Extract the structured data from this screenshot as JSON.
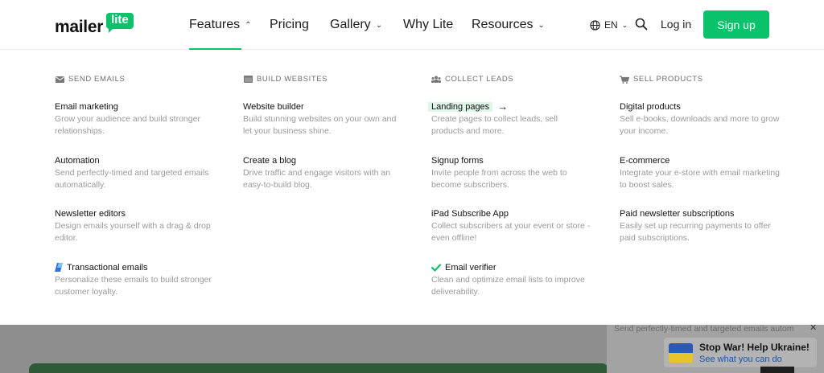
{
  "logo": {
    "word": "mailer",
    "bubble": "lite"
  },
  "nav": {
    "features": "Features",
    "pricing": "Pricing",
    "gallery": "Gallery",
    "why_lite": "Why Lite",
    "resources": "Resources"
  },
  "lang": "EN",
  "login": "Log in",
  "signup": "Sign up",
  "colors": {
    "brand_green": "#09c269",
    "highlight": "#dff5e8"
  },
  "menu": {
    "send_emails": {
      "heading": "SEND EMAILS",
      "icon": "envelope-icon",
      "items": [
        {
          "title": "Email marketing",
          "desc": "Grow your audience and build stronger relationships."
        },
        {
          "title": "Automation",
          "desc": "Send perfectly-timed and targeted emails automatically."
        },
        {
          "title": "Newsletter editors",
          "desc": "Design emails yourself with a drag & drop editor."
        },
        {
          "title": "Transactional emails",
          "desc": "Personalize these emails to build stronger customer loyalty.",
          "icon": "transactional-icon"
        }
      ]
    },
    "build_websites": {
      "heading": "BUILD WEBSITES",
      "icon": "browser-icon",
      "items": [
        {
          "title": "Website builder",
          "desc": "Build stunning websites on your own and let your business shine."
        },
        {
          "title": "Create a blog",
          "desc": "Drive traffic and engage visitors with an easy-to-build blog."
        }
      ]
    },
    "collect_leads": {
      "heading": "COLLECT LEADS",
      "icon": "people-icon",
      "items": [
        {
          "title": "Landing pages",
          "desc": "Create pages to collect leads, sell products and more.",
          "icon": "arrow-right-icon"
        },
        {
          "title": "Signup forms",
          "desc": "Invite people from across the web to become subscribers."
        },
        {
          "title": "iPad Subscribe App",
          "desc": "Collect subscribers at your event or store - even offline!"
        },
        {
          "title": "Email verifier",
          "desc": "Clean and optimize email lists to improve deliverability.",
          "icon": "checkmark-icon"
        }
      ]
    },
    "sell_products": {
      "heading": "SELL PRODUCTS",
      "icon": "cart-icon",
      "items": [
        {
          "title": "Digital products",
          "desc": "Sell e-books, downloads and more to grow your income."
        },
        {
          "title": "E-commerce",
          "desc": "Integrate your e-store with email marketing to boost sales."
        },
        {
          "title": "Paid newsletter subscriptions",
          "desc": "Easily set up recurring payments to offer paid subscriptions."
        }
      ]
    }
  },
  "background": {
    "ghost_text": "Send perfectly-timed and targeted emails autom",
    "ukraine_title": "Stop War! Help Ukraine!",
    "ukraine_link": "See what you can do"
  }
}
